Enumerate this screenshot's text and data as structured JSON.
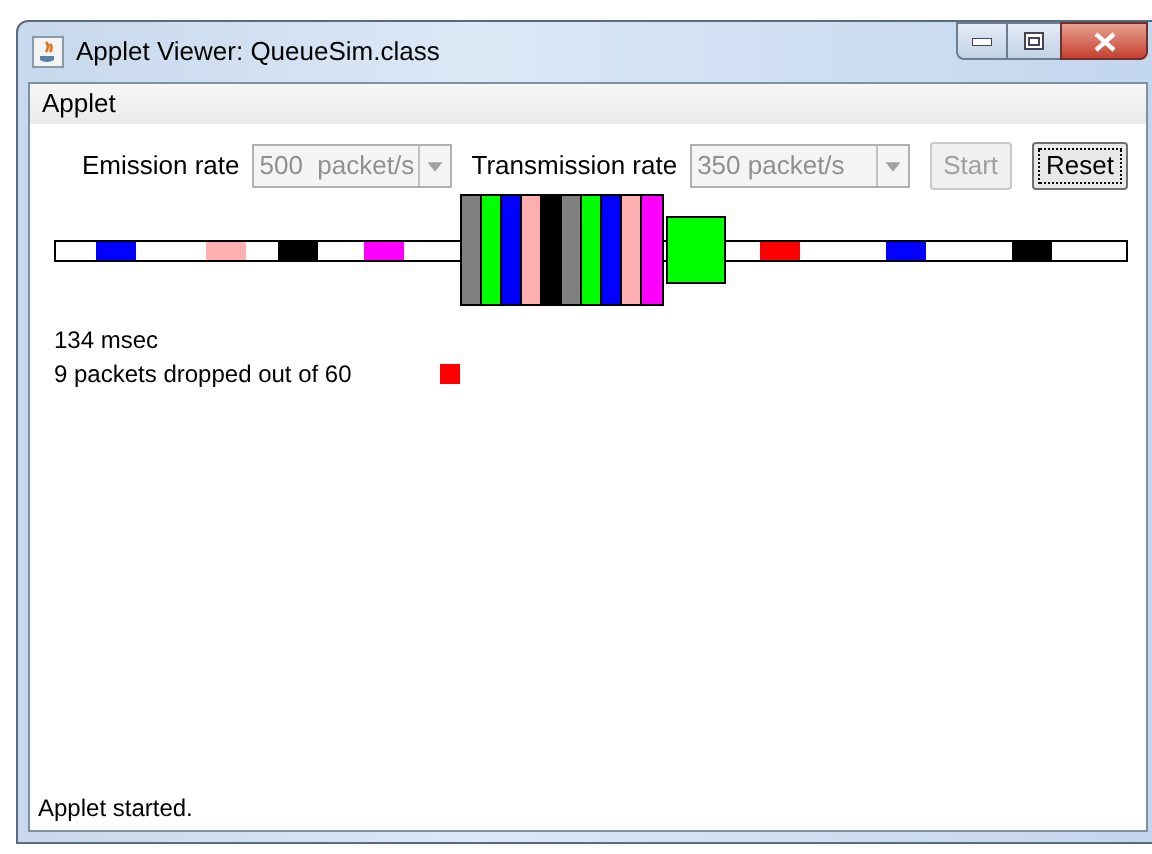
{
  "window": {
    "title": "Applet Viewer: QueueSim.class"
  },
  "menu": [
    "Applet"
  ],
  "controls": [
    {
      "kind": "combo",
      "label": "Emission rate",
      "value": "500  packet/s",
      "disabled": true
    },
    {
      "kind": "combo",
      "label": "Transmission rate",
      "value": "350 packet/s",
      "disabled": true
    },
    {
      "kind": "button",
      "label": "Start",
      "disabled": true
    },
    {
      "kind": "button",
      "label": "Reset",
      "disabled": false
    }
  ],
  "simulation": {
    "incoming": [
      {
        "color": "#0000ff"
      },
      {
        "color": "#ffafaf"
      },
      {
        "color": "#000000"
      },
      {
        "color": "#ff00ff"
      }
    ],
    "queue": [
      {
        "color": "#808080"
      },
      {
        "color": "#00ff00"
      },
      {
        "color": "#0000ff"
      },
      {
        "color": "#ffafaf"
      },
      {
        "color": "#000000"
      },
      {
        "color": "#808080"
      },
      {
        "color": "#00ff00"
      },
      {
        "color": "#0000ff"
      },
      {
        "color": "#ffafaf"
      },
      {
        "color": "#ff00ff"
      }
    ],
    "transmitting": {
      "color": "#00ff00"
    },
    "outgoing": [
      {
        "color": "#ff0000"
      },
      {
        "color": "#0000ff"
      },
      {
        "color": "#000000"
      }
    ],
    "dropped": {
      "color": "#ff0000"
    }
  },
  "stats": [
    "134 msec",
    "9 packets dropped out of 60"
  ],
  "status_bar": "Applet started."
}
